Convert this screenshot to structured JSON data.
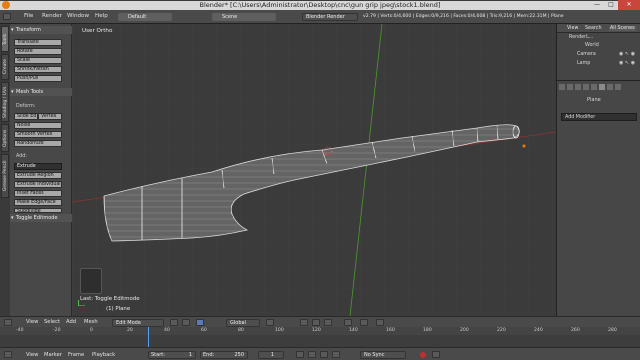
{
  "window": {
    "title": "Blender* [C:\\Users\\Administrator\\Desktop\\cnc\\gun grip jpeg\\stock1.blend]",
    "controls": [
      "—",
      "□",
      "✕"
    ]
  },
  "info_header": {
    "menus": [
      "File",
      "Render",
      "Window",
      "Help"
    ],
    "screen_layout": "Default",
    "scene": "Scene",
    "engine": "Blender Render",
    "stats": "v2.79 | Verts:0/4,600 | Edges:0/9,216 | Faces:0/4,608 | Tris:9,216 | Mem:22.31M | Plane"
  },
  "tabs": [
    "Tools",
    "Create",
    "Shading / UVs",
    "Options",
    "Grease Pencil"
  ],
  "tool_shelf": {
    "transform_header": "Transform",
    "transform_buttons": [
      "Translate",
      "Rotate",
      "Scale",
      "Shrink/Fatten",
      "Push/Pull"
    ],
    "mesh_tools_header": "Mesh Tools",
    "deform_label": "Deform:",
    "slide_buttons": [
      "Slide Ed",
      "Vertex"
    ],
    "deform_buttons": [
      "Noise",
      "Smooth Vertex",
      "Randomize"
    ],
    "add_label": "Add:",
    "extrude_select": "Extrude",
    "add_buttons": [
      "Extrude Region",
      "Extrude Individual",
      "Inset Faces",
      "Make Edge/Face",
      "Subdivide"
    ],
    "toggle_header": "Toggle Editmode"
  },
  "viewport": {
    "view_name": "User Ortho",
    "last_operator": "Last: Toggle Editmode",
    "object_label": "(1) Plane"
  },
  "outliner": {
    "header_items": [
      "View",
      "Search",
      "All Scenes"
    ],
    "items": [
      "RenderL...",
      "World",
      "Camera",
      "Lamp"
    ]
  },
  "properties": {
    "object_name": "Plane",
    "add_modifier": "Add Modifier"
  },
  "viewport_header": {
    "menus": [
      "View",
      "Select",
      "Add",
      "Mesh"
    ],
    "mode": "Edit Mode",
    "orientation": "Global"
  },
  "timeline": {
    "ruler": [
      "-40",
      "-20",
      "0",
      "20",
      "40",
      "60",
      "80",
      "100",
      "120",
      "140",
      "160",
      "180",
      "200",
      "220",
      "240",
      "260",
      "280"
    ],
    "menus": [
      "View",
      "Marker",
      "Frame",
      "Playback"
    ],
    "start_label": "Start:",
    "start_value": "1",
    "end_label": "End:",
    "end_value": "250",
    "current_frame": "1",
    "sync": "No Sync"
  },
  "colors": {
    "accent": "#e87d0d",
    "viewport_bg": "#3b3b3b",
    "x_axis": "#9b3a3a",
    "y_axis": "#4c9a2a",
    "close": "#c9463d"
  }
}
